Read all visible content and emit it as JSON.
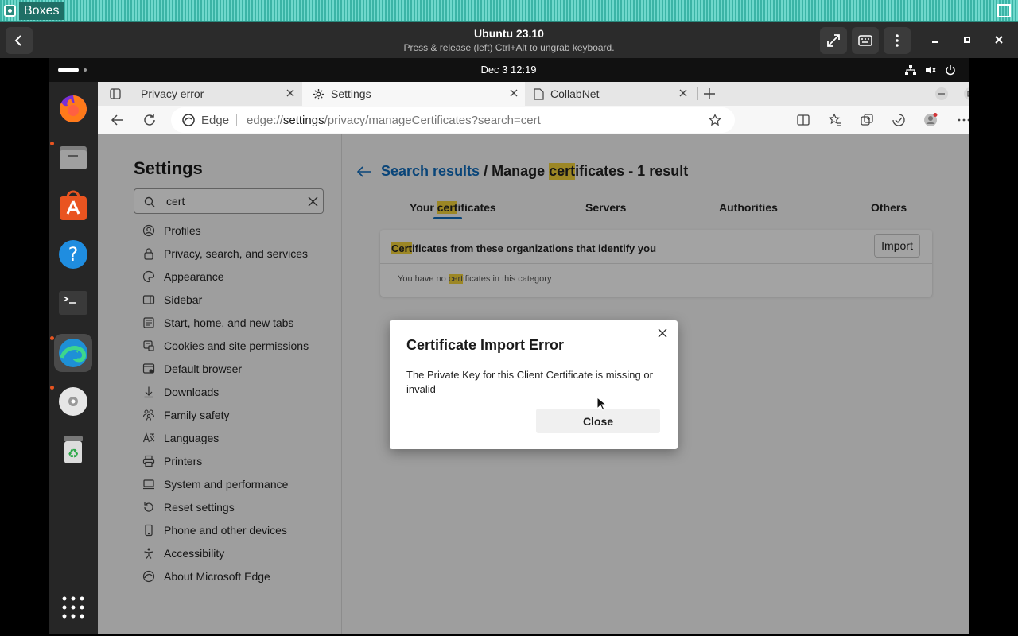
{
  "host": {
    "app_title": "Boxes",
    "vm_title": "Ubuntu 23.10",
    "vm_subtitle": "Press & release (left) Ctrl+Alt to ungrab keyboard."
  },
  "guest_topbar": {
    "clock": "Dec 3  12:19"
  },
  "dock": {
    "items": [
      {
        "name": "Firefox",
        "icon": "firefox-icon",
        "running": true
      },
      {
        "name": "Files",
        "icon": "files-icon",
        "running": false
      },
      {
        "name": "App Center",
        "icon": "app-center-icon",
        "running": false
      },
      {
        "name": "Help",
        "icon": "help-icon",
        "running": false
      },
      {
        "name": "Terminal",
        "icon": "terminal-icon",
        "running": true
      },
      {
        "name": "Microsoft Edge",
        "icon": "edge-icon",
        "running": true,
        "active": true
      },
      {
        "name": "Disc",
        "icon": "disc-icon",
        "running": false
      },
      {
        "name": "Trash",
        "icon": "trash-icon",
        "running": false
      }
    ]
  },
  "browser": {
    "tabs": [
      {
        "label": "Privacy error"
      },
      {
        "label": "Settings",
        "active": true
      },
      {
        "label": "CollabNet"
      }
    ],
    "address": {
      "site_name": "Edge",
      "url_scheme": "edge://",
      "url_host": "settings",
      "url_path": "/privacy/manageCertificates?search=cert"
    }
  },
  "settings": {
    "title": "Settings",
    "search_value": "cert",
    "nav_items": [
      {
        "label": "Profiles",
        "icon": "profile-icon"
      },
      {
        "label": "Privacy, search, and services",
        "icon": "lock-icon"
      },
      {
        "label": "Appearance",
        "icon": "appearance-icon"
      },
      {
        "label": "Sidebar",
        "icon": "sidebar-icon"
      },
      {
        "label": "Start, home, and new tabs",
        "icon": "home-icon"
      },
      {
        "label": "Cookies and site permissions",
        "icon": "cookies-icon"
      },
      {
        "label": "Default browser",
        "icon": "browser-icon"
      },
      {
        "label": "Downloads",
        "icon": "download-icon"
      },
      {
        "label": "Family safety",
        "icon": "family-icon"
      },
      {
        "label": "Languages",
        "icon": "languages-icon"
      },
      {
        "label": "Printers",
        "icon": "printer-icon"
      },
      {
        "label": "System and performance",
        "icon": "system-icon"
      },
      {
        "label": "Reset settings",
        "icon": "reset-icon"
      },
      {
        "label": "Phone and other devices",
        "icon": "phone-icon"
      },
      {
        "label": "Accessibility",
        "icon": "accessibility-icon"
      },
      {
        "label": "About Microsoft Edge",
        "icon": "edge-logo-icon"
      }
    ],
    "breadcrumb": {
      "link": "Search results",
      "sep": " / ",
      "prefix": "Manage ",
      "highlight": "cert",
      "suffix": "ificates - 1 result"
    },
    "cert_tabs": {
      "your_prefix": "Your ",
      "your_highlight": "cert",
      "your_suffix": "ificates",
      "servers": "Servers",
      "authorities": "Authorities",
      "others": "Others"
    },
    "card": {
      "head_highlight": "Cert",
      "head_suffix": "ificates from these organizations that identify you",
      "import_label": "Import",
      "empty_prefix": "You have no ",
      "empty_highlight": "cert",
      "empty_suffix": "ificates in this category"
    }
  },
  "dialog": {
    "title": "Certificate Import Error",
    "message": "The Private Key for this Client Certificate is missing or invalid",
    "close_label": "Close"
  },
  "colors": {
    "accent": "#0f6cbd",
    "highlight": "#f5d33b",
    "ubuntu_orange": "#e95420",
    "boxes_teal": "#3bb4a6"
  }
}
